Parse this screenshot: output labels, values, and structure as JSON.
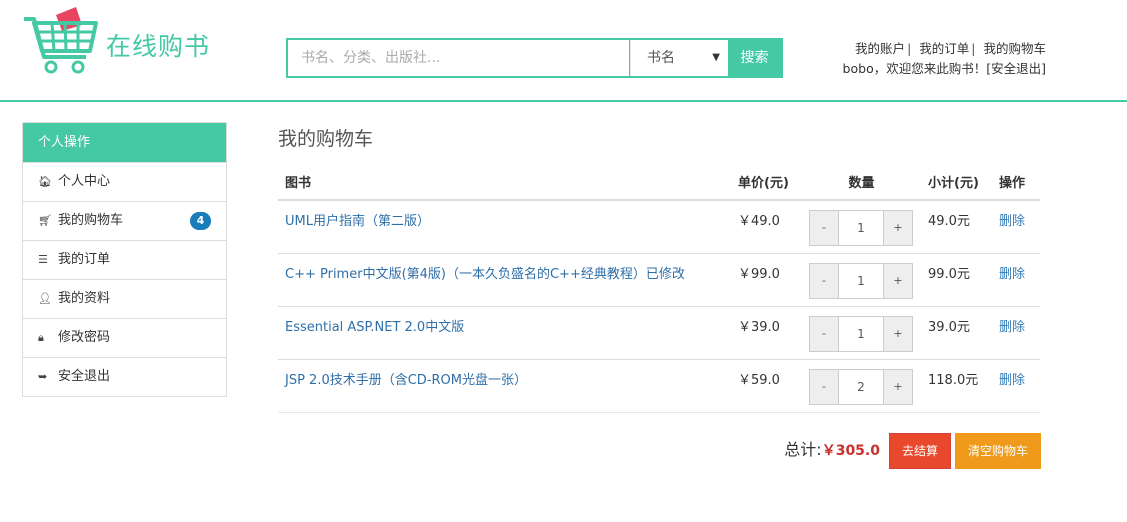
{
  "brand": {
    "name": "在线购书",
    "accent": "#45c9a4"
  },
  "search": {
    "placeholder": "书名、分类、出版社...",
    "category": "书名",
    "button": "搜索"
  },
  "toplinks": {
    "account": "我的账户",
    "orders": "我的订单",
    "cart": "我的购物车",
    "username": "bobo",
    "welcome": "，欢迎您来此购书！",
    "logout": "[安全退出]"
  },
  "sidebar": {
    "header": "个人操作",
    "items": [
      {
        "label": "个人中心",
        "icon": "home-icon",
        "glyph": "🏠︎"
      },
      {
        "label": "我的购物车",
        "icon": "cart-icon",
        "glyph": "🛒︎",
        "badge": "4"
      },
      {
        "label": "我的订单",
        "icon": "list-icon",
        "glyph": "☰"
      },
      {
        "label": "我的资料",
        "icon": "user-icon",
        "glyph": "👤︎"
      },
      {
        "label": "修改密码",
        "icon": "lock-icon",
        "glyph": "🔒︎"
      },
      {
        "label": "安全退出",
        "icon": "sign-out-icon",
        "glyph": "➥"
      }
    ]
  },
  "main": {
    "title": "我的购物车",
    "columns": [
      "图书",
      "单价(元)",
      "数量",
      "小计(元)",
      "操作"
    ],
    "rows": [
      {
        "title": "UML用户指南（第二版）",
        "price": "￥49.0",
        "qty": "1",
        "subtotal": "49.0元",
        "action": "删除"
      },
      {
        "title": "C++ Primer中文版(第4版)（一本久负盛名的C++经典教程）已修改",
        "price": "￥99.0",
        "qty": "1",
        "subtotal": "99.0元",
        "action": "删除"
      },
      {
        "title": "Essential ASP.NET 2.0中文版",
        "price": "￥39.0",
        "qty": "1",
        "subtotal": "39.0元",
        "action": "删除"
      },
      {
        "title": "JSP 2.0技术手册（含CD-ROM光盘一张）",
        "price": "￥59.0",
        "qty": "2",
        "subtotal": "118.0元",
        "action": "删除"
      }
    ],
    "minus": "-",
    "plus": "+",
    "total_label": "总计:",
    "total_value": "￥305.0",
    "checkout": "去结算",
    "clear": "清空购物车"
  }
}
